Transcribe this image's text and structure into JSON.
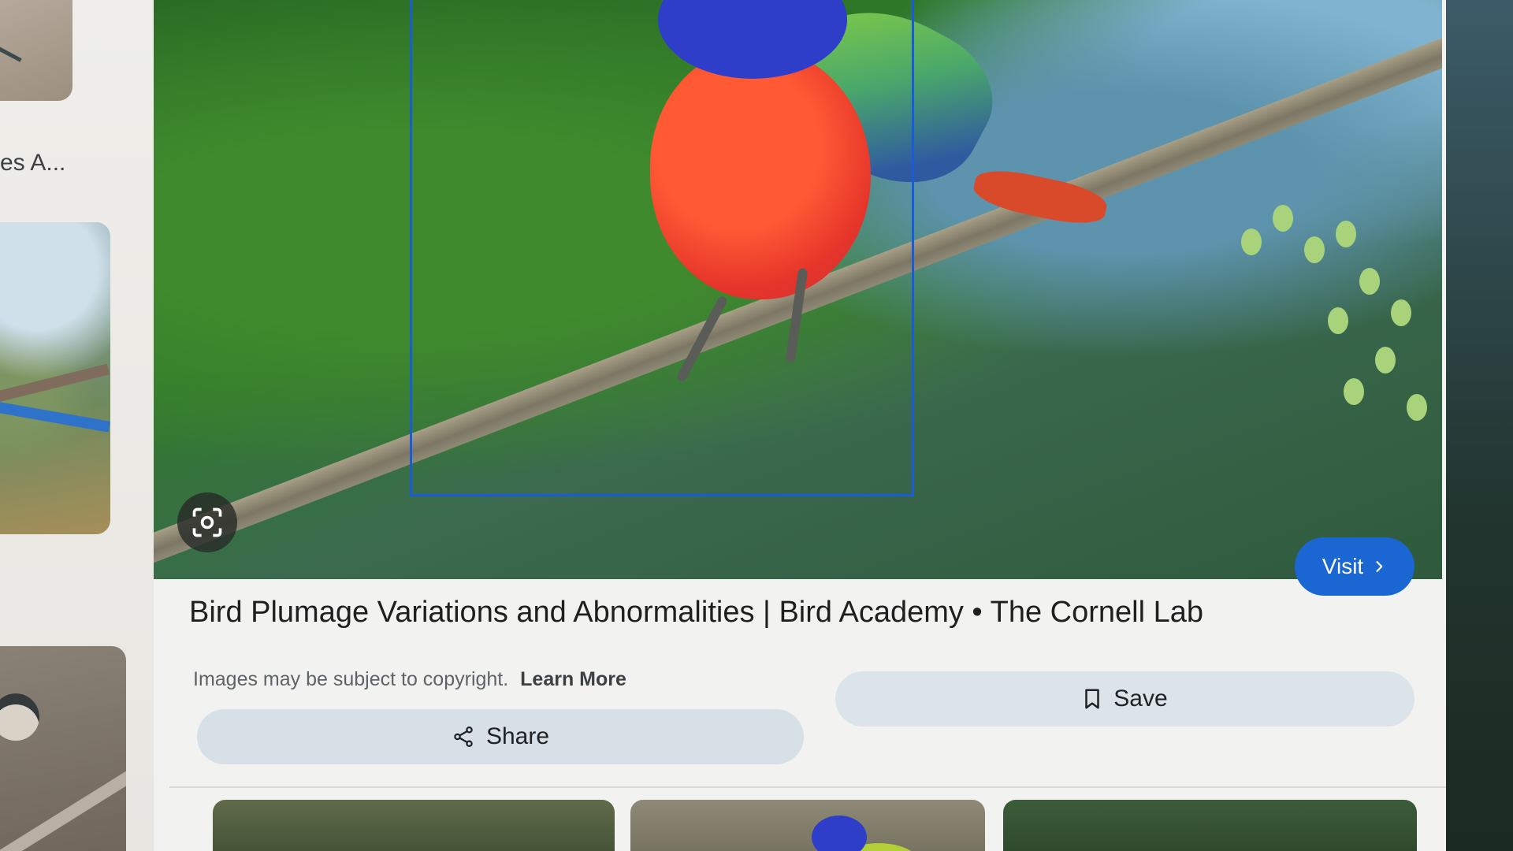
{
  "left_column": {
    "truncated_caption": "es A..."
  },
  "result": {
    "title": "Bird Plumage Variations and Abnormalities | Bird Academy • The Cornell Lab",
    "visit_label": "Visit",
    "copyright_text": "Images may be subject to copyright.",
    "learn_more_label": "Learn More",
    "share_label": "Share",
    "save_label": "Save"
  },
  "colors": {
    "accent": "#1a66d2",
    "selection_box": "#1a5bd8"
  },
  "icons": {
    "lens": "google-lens-icon",
    "visit_chevron": "chevron-right-icon",
    "share": "share-icon",
    "save": "bookmark-icon"
  }
}
